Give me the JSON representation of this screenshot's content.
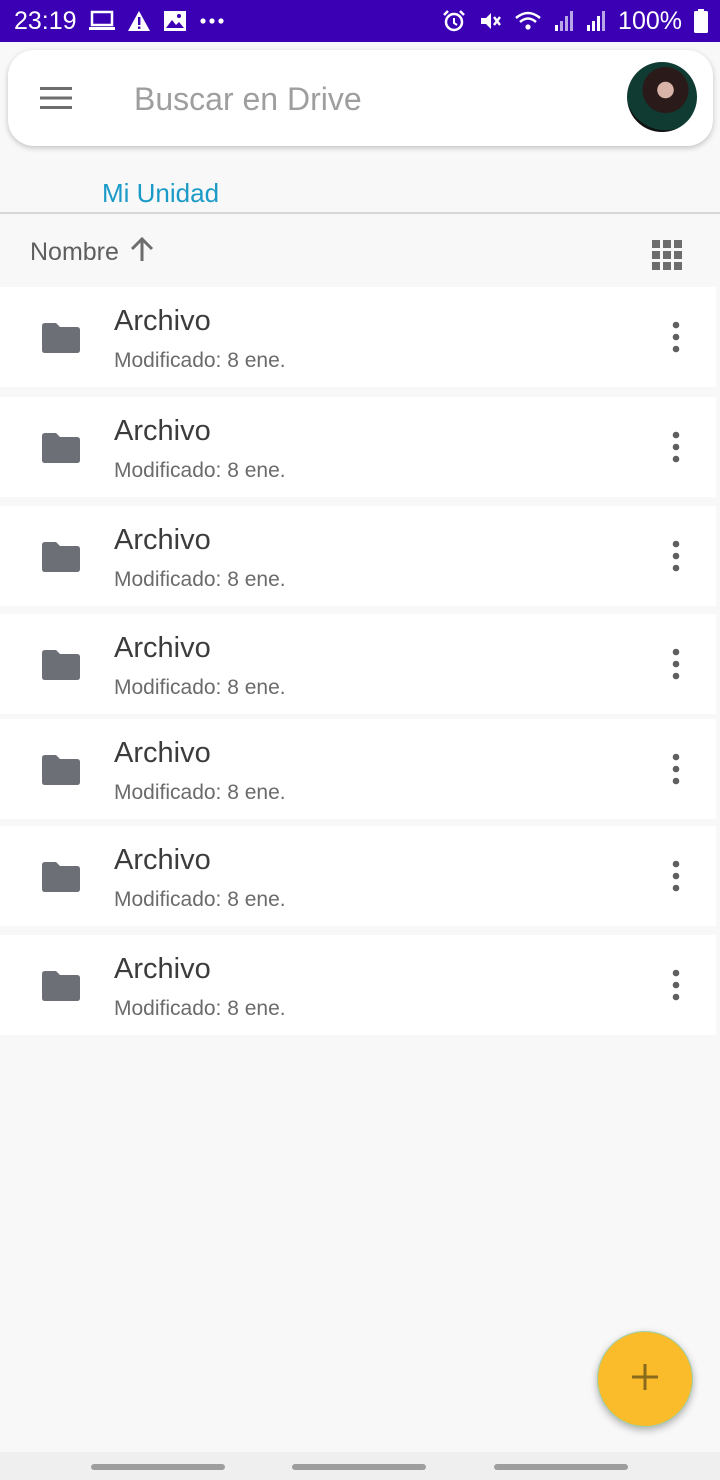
{
  "status_bar": {
    "time": "23:19",
    "battery": "100%",
    "left_icons": [
      "laptop-icon",
      "warning-icon",
      "image-icon",
      "more-dots-icon"
    ],
    "right_icons": [
      "alarm-icon",
      "mute-icon",
      "wifi-icon",
      "signal-icon",
      "signal-icon",
      "battery-icon"
    ],
    "background": "#3b00b3"
  },
  "search": {
    "placeholder": "Buscar en Drive",
    "value": ""
  },
  "breadcrumb": {
    "label": "Mi Unidad",
    "color": "#1a9bc7"
  },
  "sort": {
    "label": "Nombre",
    "direction": "ascending"
  },
  "files": [
    {
      "name": "Archivo",
      "meta": "Modificado: 8 ene."
    },
    {
      "name": "Archivo",
      "meta": "Modificado: 8 ene."
    },
    {
      "name": "Archivo",
      "meta": "Modificado: 8 ene."
    },
    {
      "name": "Archivo",
      "meta": "Modificado: 8 ene."
    },
    {
      "name": "Archivo",
      "meta": "Modificado: 8 ene."
    },
    {
      "name": "Archivo",
      "meta": "Modificado: 8 ene."
    },
    {
      "name": "Archivo",
      "meta": "Modificado: 8 ene."
    }
  ],
  "fab": {
    "icon": "plus-icon",
    "color": "#fbbc2c"
  }
}
